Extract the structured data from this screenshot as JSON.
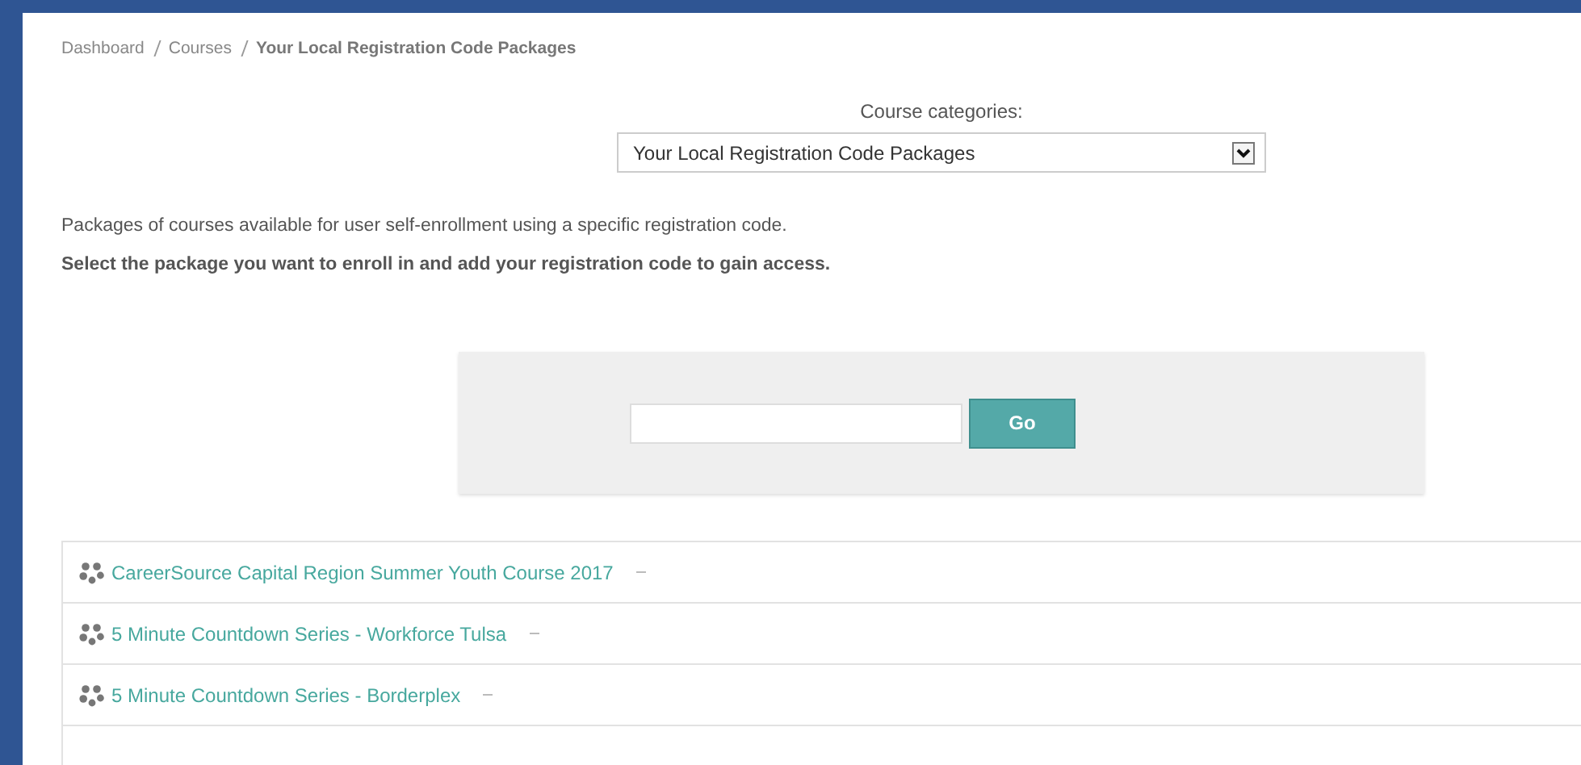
{
  "breadcrumb": [
    {
      "label": "Dashboard",
      "current": false
    },
    {
      "label": "Courses",
      "current": false
    },
    {
      "label": "Your Local Registration Code Packages",
      "current": true
    }
  ],
  "category_select": {
    "label": "Course categories:",
    "value": "Your Local Registration Code Packages"
  },
  "intro": "Packages of courses available for user self-enrollment using a specific registration code.",
  "instruction": "Select the package you want to enroll in and add your registration code to gain access.",
  "code_form": {
    "button": "Go"
  },
  "packages": [
    {
      "title": "CareerSource Capital Region Summer Youth Course 2017"
    },
    {
      "title": "5 Minute Countdown Series - Workforce Tulsa"
    },
    {
      "title": "5 Minute Countdown Series - Borderplex"
    }
  ]
}
